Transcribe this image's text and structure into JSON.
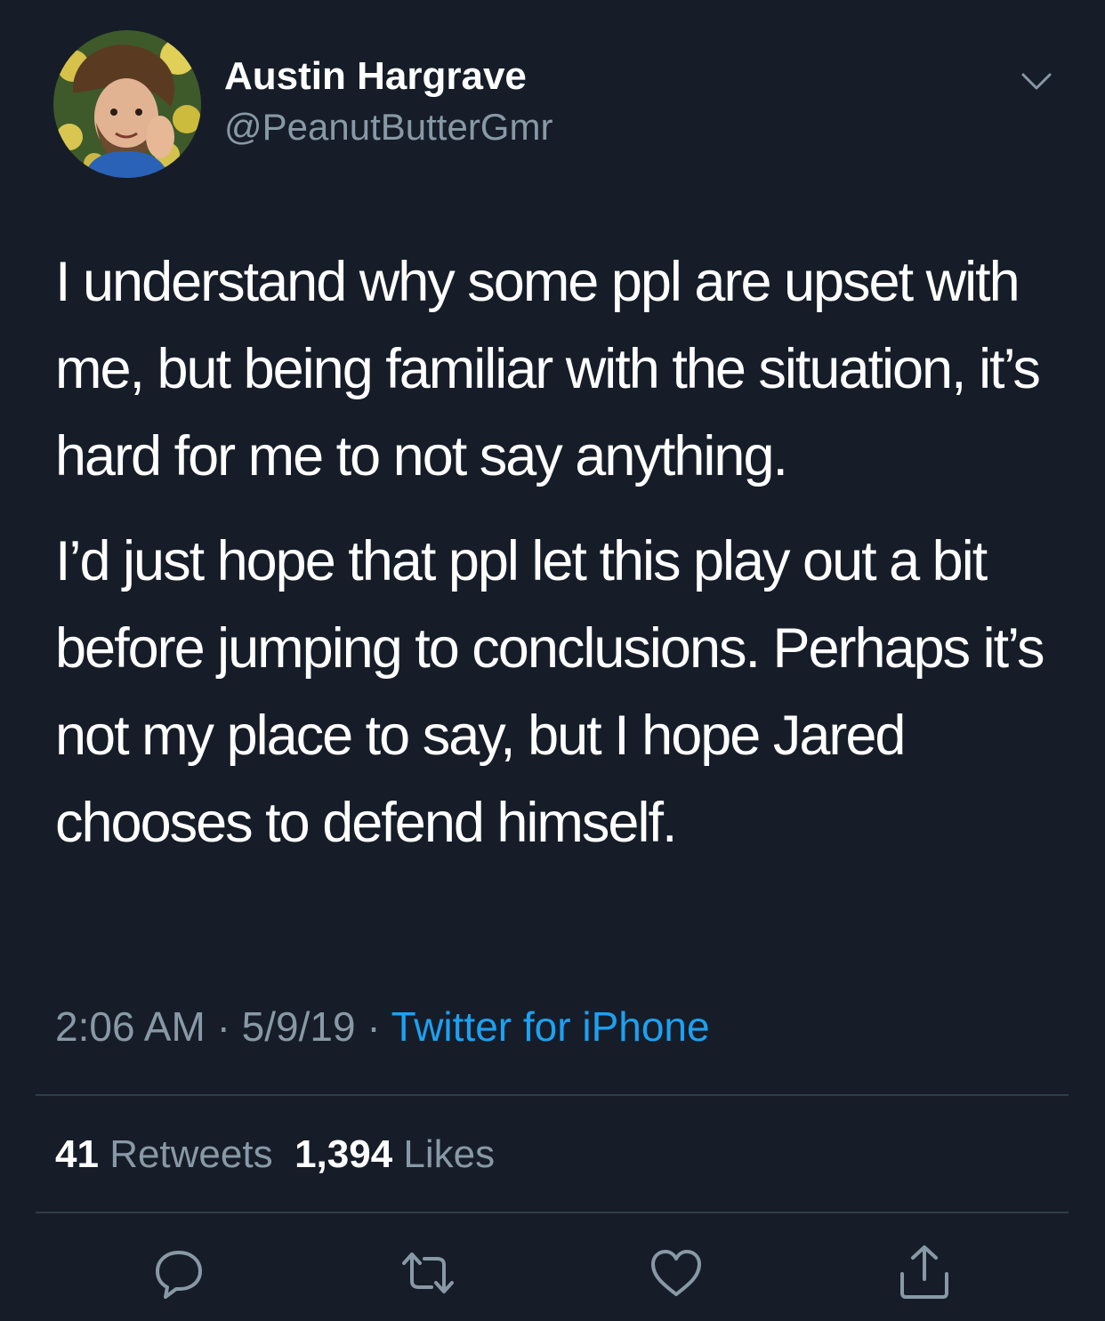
{
  "tweet": {
    "author": {
      "display_name": "Austin Hargrave",
      "handle": "@PeanutButterGmr"
    },
    "paragraphs": [
      "I understand why some ppl are upset with me, but being familiar with the situation, it’s hard for me to not say anything.",
      "I’d just hope that ppl let this play out a bit before jumping to conclusions. Perhaps it’s not my place to say, but I hope Jared chooses to defend himself."
    ],
    "time": "2:06 AM",
    "date": "5/9/19",
    "separator": "·",
    "source": "Twitter for iPhone",
    "retweets_count": "41",
    "retweets_label": "Retweets",
    "likes_count": "1,394",
    "likes_label": "Likes"
  },
  "icons": {
    "menu": "chevron-down-icon",
    "reply": "reply-icon",
    "retweet": "retweet-icon",
    "like": "heart-icon",
    "share": "share-icon"
  },
  "colors": {
    "background": "#161d28",
    "text": "#ffffff",
    "secondary": "#8899a6",
    "link": "#1da1f2",
    "divider": "#2f3b47"
  }
}
